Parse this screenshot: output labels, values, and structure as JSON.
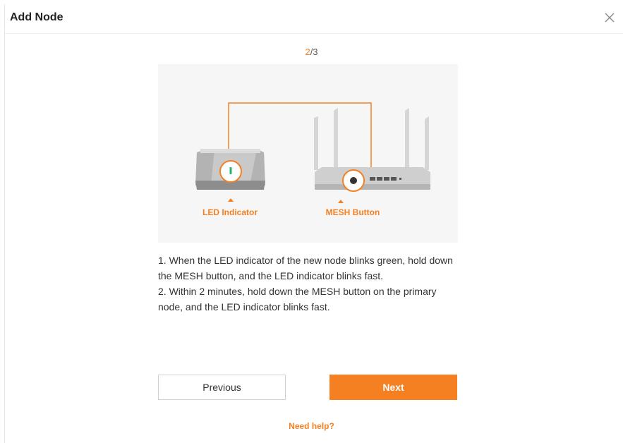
{
  "dialog": {
    "title": "Add Node",
    "close_icon": "close-icon"
  },
  "step": {
    "current": "2",
    "total": "/3"
  },
  "illustration": {
    "led_label": "LED Indicator",
    "mesh_label": "MESH Button",
    "accent_color": "#f48022"
  },
  "instructions": [
    "1. When the LED indicator of the new node blinks green, hold down the MESH button, and the LED indicator blinks fast.",
    "2. Within 2 minutes, hold down the MESH button on the primary node, and the LED indicator blinks fast."
  ],
  "buttons": {
    "previous": "Previous",
    "next": "Next"
  },
  "help": {
    "link": "Need help?"
  }
}
